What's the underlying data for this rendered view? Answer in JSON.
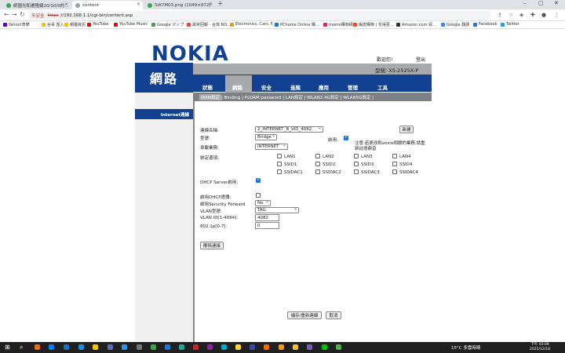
{
  "browser": {
    "tabs": [
      {
        "label": "師國光和遷隆線20/10/0的…",
        "active": false
      },
      {
        "label": "content",
        "active": true
      },
      {
        "label": "SIA7M03.png (1049×872)",
        "active": false
      }
    ],
    "address": {
      "warning": "不安全",
      "scheme": "https",
      "rest": "://192.168.1.1/cgi-bin/content.asp"
    },
    "bookmarks": [
      "Yahoo!奇摩",
      "谷哥 匯入",
      "網優資訊",
      "YouTube",
      "YouTube Music",
      "Google マップ",
      "異常回報 - 台灣 NO...",
      "Electronics, Cars, F...",
      "PChome Online 購...",
      "momo購物網",
      "蝦皮購物 | 花得更...",
      "Amazon.com:買...",
      "Google 翻譯",
      "Facebook",
      "Twitter"
    ]
  },
  "header": {
    "brand": "NOKIA",
    "user_label": "歡迎您!",
    "logout_label": "登出",
    "model": "型號: XS-2525X-P",
    "section_title": "網路",
    "nav": [
      "狀態",
      "網路",
      "安全",
      "進階",
      "應用",
      "管理",
      "工具"
    ],
    "active_nav": "網路",
    "subnav_current": "WAN設定",
    "subnav_rest": "| Binding | PLOAM password | LAN設定 | WLAN2.4G設定 | WLAN5G設定 |"
  },
  "sidebar": {
    "items": [
      "Internet連線"
    ]
  },
  "form": {
    "conn_name_label": "連線名稱:",
    "conn_name_value": "2_INTERNET_B_VID_4082",
    "new_button": "新建",
    "mode_label": "型號:",
    "mode_value": "Bridge",
    "enable_label": "啟用:",
    "service_label": "承載業務:",
    "service_value": "INTERNET",
    "note": "注意:若更改和voice相關的業務,請重新註冊鼎音",
    "bind_label": "綁定邊項:",
    "bind_options": [
      "LAN1",
      "LAN2",
      "LAN3",
      "LAN4",
      "SSID1",
      "SSID2",
      "SSID3",
      "SSID4",
      "SSIDAC1",
      "SSIDAC2",
      "SSIDAC3",
      "SSIDAC4"
    ],
    "dhcp_server_label": "DHCP Server啟用:",
    "dhcp_relay_label": "啟用DHCP透傳:",
    "security_fwd_label": "啟用Security Forward",
    "security_fwd_value": "No",
    "vlan_mode_label": "VLAN型號:",
    "vlan_mode_value": "TAG",
    "vlan_id_label": "VLAN ID[1-4094]:",
    "vlan_id_value": "4082",
    "priority_label": "802.1p[0-7]:",
    "priority_value": "0",
    "delete_button": "刪除連接",
    "save_button": "儲存/重新連線",
    "cancel_button": "取消"
  },
  "taskbar": {
    "weather": "15°C 多雲時晴",
    "time": "下午 03:09",
    "date": "2022/12/18"
  }
}
